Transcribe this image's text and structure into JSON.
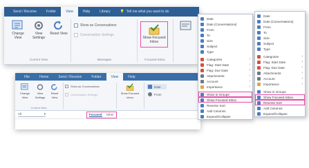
{
  "window1": {
    "tabs": [
      "Send / Receive",
      "Folder",
      "View",
      "Help",
      "Library",
      "Tell me what you want to do"
    ],
    "active_tab_index": 2,
    "buttons": {
      "change_view": "Change View",
      "view_settings": "View Settings",
      "reset_view": "Reset View",
      "show_as_conversations": "Show as Conversations",
      "conversation_settings": "Conversation Settings",
      "group_label": "Messages",
      "show_focused_inbox": "Show Focused Inbox",
      "focused_group_label": "Focused Inbox",
      "current_view_label": "Current View"
    }
  },
  "window2": {
    "tabs": [
      "File",
      "Home",
      "Send / Receive",
      "Folder",
      "View",
      "Help"
    ],
    "active_tab_index": 4,
    "buttons": {
      "change_view": "Change View",
      "view_settings": "View Settings",
      "reset_view": "Reset View",
      "show_as_conversations": "Show as Conversations",
      "conversation_settings": "Conversation Settings",
      "show_focused_inbox": "Show Focused Inbox",
      "group_label": "Current View",
      "sort_date": "Date",
      "sort_from": "From"
    },
    "filter_label": "All",
    "focused_tabs": [
      "Focused",
      "Other"
    ]
  },
  "menu1": {
    "items": [
      {
        "label": "Date",
        "color": "#4a7dbf"
      },
      {
        "label": "Date (Conversations)",
        "color": "#4a7dbf"
      },
      {
        "label": "From",
        "color": "#4a7dbf"
      },
      {
        "label": "To",
        "color": "#4a7dbf"
      },
      {
        "label": "Size",
        "color": "#4a7dbf"
      },
      {
        "label": "Subject",
        "color": "#4a7dbf"
      },
      {
        "label": "Type",
        "color": "#4a7dbf"
      },
      {
        "label": "Categories",
        "color": "#d4503e"
      },
      {
        "label": "Flag: Start Date",
        "color": "#d4503e"
      },
      {
        "label": "Flag: Due Date",
        "color": "#d4503e"
      },
      {
        "label": "Attachments",
        "color": "#6c7a89"
      },
      {
        "label": "Account",
        "color": "#6c7a89"
      },
      {
        "label": "Importance",
        "color": "#e8a33d"
      },
      {
        "label": "Show in Groups",
        "color": "#4a7dbf"
      },
      {
        "label": "Show Focused Inbox",
        "color": "#4a7dbf"
      },
      {
        "label": "Reverse Sort",
        "color": "#4a7dbf"
      },
      {
        "label": "Add Columns",
        "color": "#4a7dbf"
      },
      {
        "label": "Expand/Collapse",
        "color": "#4a7dbf"
      }
    ],
    "highlighted_indices": [
      13,
      14
    ]
  },
  "menu2": {
    "items": [
      {
        "label": "Date",
        "color": "#4a7dbf"
      },
      {
        "label": "Date (Conversations)",
        "color": "#4a7dbf"
      },
      {
        "label": "From",
        "color": "#4a7dbf"
      },
      {
        "label": "To",
        "color": "#4a7dbf"
      },
      {
        "label": "Size",
        "color": "#4a7dbf"
      },
      {
        "label": "Subject",
        "color": "#4a7dbf"
      },
      {
        "label": "Type",
        "color": "#4a7dbf"
      },
      {
        "label": "Categories",
        "color": "#d4503e"
      },
      {
        "label": "Flag: Start Date",
        "color": "#d4503e"
      },
      {
        "label": "Flag: Due Date",
        "color": "#d4503e"
      },
      {
        "label": "Attachments",
        "color": "#6c7a89"
      },
      {
        "label": "Account",
        "color": "#6c7a89"
      },
      {
        "label": "Importance",
        "color": "#e8a33d"
      },
      {
        "label": "Show in Groups",
        "color": "#4a7dbf"
      },
      {
        "label": "Show Focused Inbox",
        "color": "#4a7dbf"
      },
      {
        "label": "Reverse Sort",
        "color": "#4a7dbf"
      },
      {
        "label": "Add Columns",
        "color": "#4a7dbf"
      },
      {
        "label": "Expand/Collapse",
        "color": "#4a7dbf"
      }
    ],
    "highlighted_indices": [
      14,
      15
    ]
  },
  "colors": {
    "tabbar": "#2e5f94",
    "highlight": "#e64fa8",
    "ribbon_bg": "#f4f6f9"
  }
}
